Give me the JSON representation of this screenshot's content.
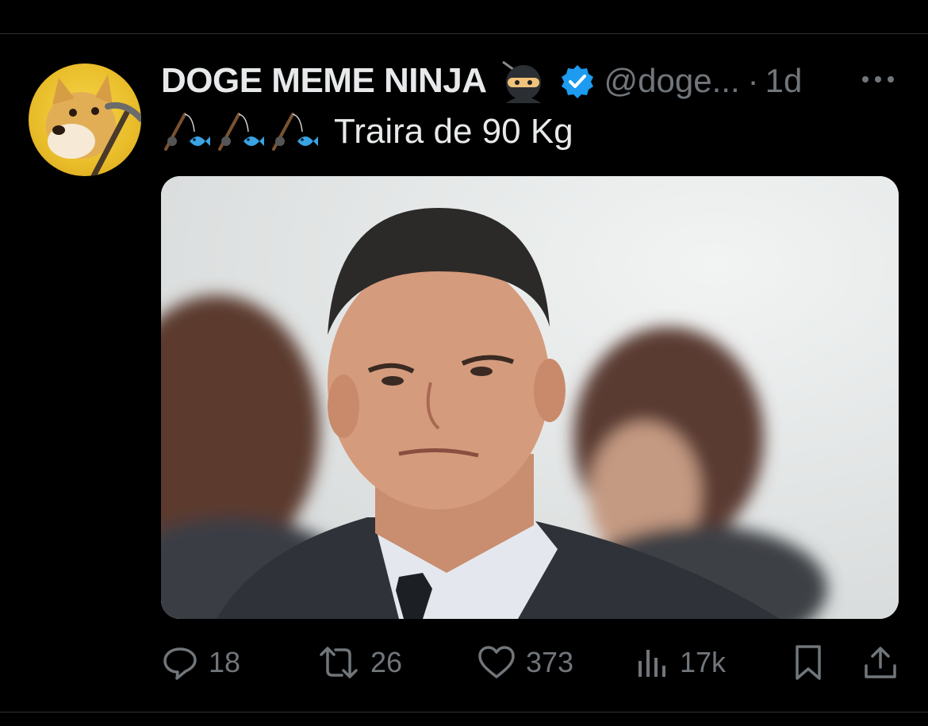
{
  "tweet": {
    "author": {
      "display_name": "DOGE MEME NINJA",
      "handle": "@doge...",
      "time": "1d",
      "separator": "·",
      "avatar_icon": "doge-avatar",
      "name_emoji_icon": "ninja-icon",
      "verified_icon": "verified-badge-icon"
    },
    "text": {
      "emoji_icons": [
        "fishing-pole-icon",
        "fishing-pole-icon",
        "fishing-pole-icon"
      ],
      "body": "Traira de 90 Kg"
    },
    "media": {
      "icon": "photo-man-in-suit"
    },
    "actions": {
      "replies": "18",
      "retweets": "26",
      "likes": "373",
      "views": "17k"
    }
  },
  "colors": {
    "background": "#000000",
    "text_primary": "#e7e9ea",
    "text_secondary": "#71767b",
    "verified_blue": "#1d9bf0",
    "divider": "#2f3336"
  }
}
